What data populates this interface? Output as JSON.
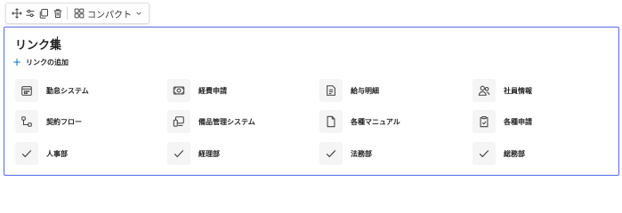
{
  "toolbar": {
    "buttons": [
      {
        "icon": "move-icon"
      },
      {
        "icon": "edit-properties-icon"
      },
      {
        "icon": "duplicate-icon"
      },
      {
        "icon": "delete-icon"
      }
    ],
    "layout_label": "コンパクト",
    "layout_icon": "grid-layout-icon"
  },
  "webpart": {
    "title": "リンク集",
    "add_link_label": "リンクの追加",
    "accent_color": "#4f6bed",
    "links": [
      {
        "label": "勤怠システム",
        "icon": "calendar-icon"
      },
      {
        "label": "経費申請",
        "icon": "money-icon"
      },
      {
        "label": "給与明細",
        "icon": "document-icon"
      },
      {
        "label": "社員情報",
        "icon": "people-icon"
      },
      {
        "label": "契約フロー",
        "icon": "flow-icon"
      },
      {
        "label": "備品管理システム",
        "icon": "devices-icon"
      },
      {
        "label": "各種マニュアル",
        "icon": "page-icon"
      },
      {
        "label": "各種申請",
        "icon": "clipboard-icon"
      },
      {
        "label": "人事部",
        "icon": "checkmark-icon"
      },
      {
        "label": "経理部",
        "icon": "checkmark-icon"
      },
      {
        "label": "法務部",
        "icon": "checkmark-icon"
      },
      {
        "label": "総務部",
        "icon": "checkmark-icon"
      }
    ]
  }
}
